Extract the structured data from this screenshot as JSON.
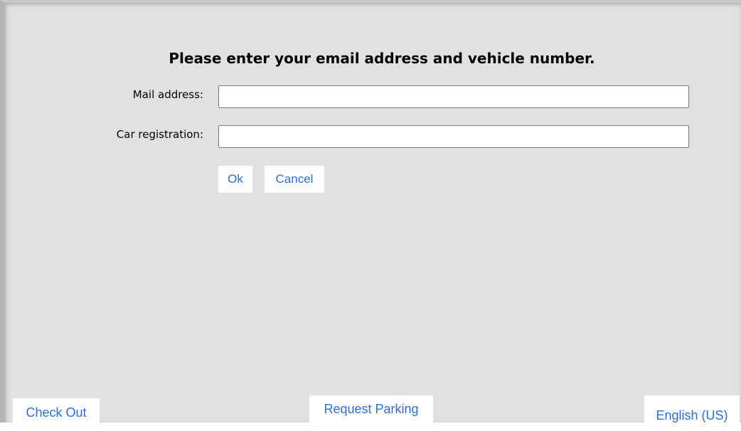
{
  "prompt": {
    "title": "Please enter your email address and vehicle number."
  },
  "form": {
    "mail_label": "Mail address:",
    "mail_value": "",
    "mail_placeholder": "",
    "car_label": "Car registration:",
    "car_value": "",
    "car_placeholder": ""
  },
  "actions": {
    "ok_label": "Ok",
    "cancel_label": "Cancel"
  },
  "footer": {
    "checkout_label": "Check Out",
    "request_label": "Request Parking",
    "language_label": "English (US)"
  },
  "colors": {
    "background": "#e1e1e1",
    "link_text": "#2f6ed6",
    "button_bg": "#ffffff"
  }
}
